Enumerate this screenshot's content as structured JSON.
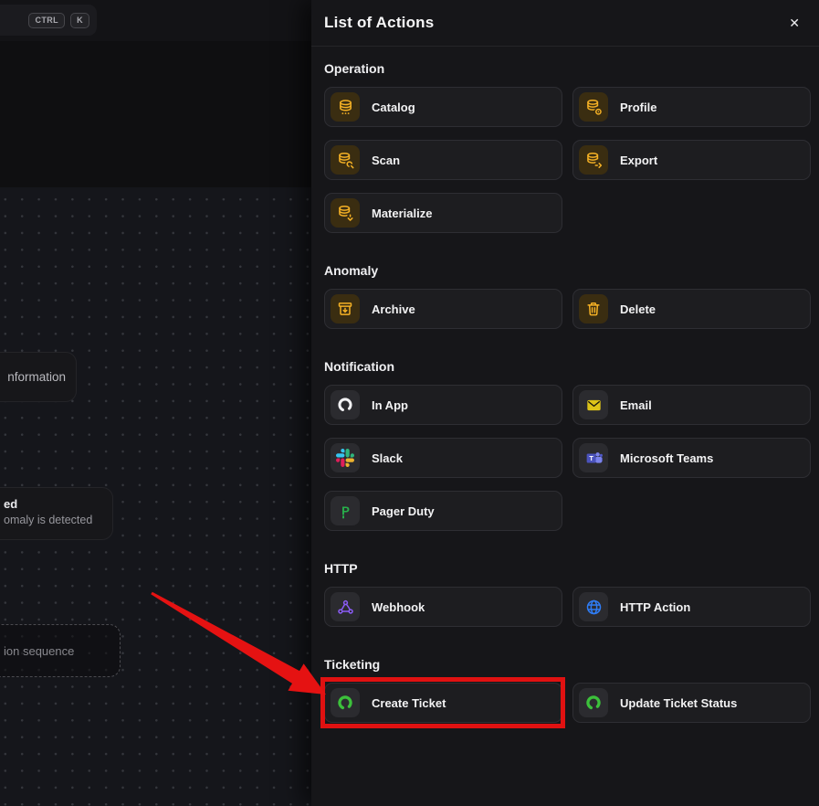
{
  "canvas": {
    "shortcut_keys": [
      "CTRL",
      "K"
    ],
    "info_node_label": "nformation",
    "detect_node_title": "ed",
    "detect_node_subtitle": "omaly is detected",
    "sequence_node_label": "ion sequence"
  },
  "panel": {
    "title": "List of Actions",
    "close_glyph": "✕",
    "sections": [
      {
        "title": "Operation",
        "items": [
          {
            "label": "Catalog",
            "icon": "catalog-database-icon",
            "style": "amber"
          },
          {
            "label": "Profile",
            "icon": "profile-database-icon",
            "style": "amber"
          },
          {
            "label": "Scan",
            "icon": "scan-database-icon",
            "style": "amber"
          },
          {
            "label": "Export",
            "icon": "export-database-icon",
            "style": "amber"
          },
          {
            "label": "Materialize",
            "icon": "materialize-database-icon",
            "style": "amber"
          }
        ]
      },
      {
        "title": "Anomaly",
        "items": [
          {
            "label": "Archive",
            "icon": "archive-box-icon",
            "style": "amber"
          },
          {
            "label": "Delete",
            "icon": "trash-icon",
            "style": "amber"
          }
        ]
      },
      {
        "title": "Notification",
        "items": [
          {
            "label": "In App",
            "icon": "in-app-logo-icon",
            "style": "neutral"
          },
          {
            "label": "Email",
            "icon": "email-envelope-icon",
            "style": "neutral"
          },
          {
            "label": "Slack",
            "icon": "slack-logo-icon",
            "style": "neutral"
          },
          {
            "label": "Microsoft Teams",
            "icon": "microsoft-teams-logo-icon",
            "style": "neutral"
          },
          {
            "label": "Pager Duty",
            "icon": "pagerduty-logo-icon",
            "style": "neutral"
          }
        ]
      },
      {
        "title": "HTTP",
        "items": [
          {
            "label": "Webhook",
            "icon": "webhook-icon",
            "style": "neutral"
          },
          {
            "label": "HTTP Action",
            "icon": "globe-icon",
            "style": "neutral"
          }
        ]
      },
      {
        "title": "Ticketing",
        "items": [
          {
            "label": "Create Ticket",
            "icon": "ticket-logo-icon",
            "style": "neutral",
            "highlighted": true
          },
          {
            "label": "Update Ticket Status",
            "icon": "ticket-logo-icon",
            "style": "neutral"
          }
        ]
      }
    ]
  },
  "colors": {
    "accent_amber": "#f5b125",
    "highlight_red": "#e01111",
    "panel_bg": "#161619",
    "button_bg": "#1d1d20",
    "ticket_green": "#3cc13b",
    "email_yellow": "#ddc418",
    "webhook_purple": "#8b5cf6",
    "http_blue": "#2f7df6"
  }
}
